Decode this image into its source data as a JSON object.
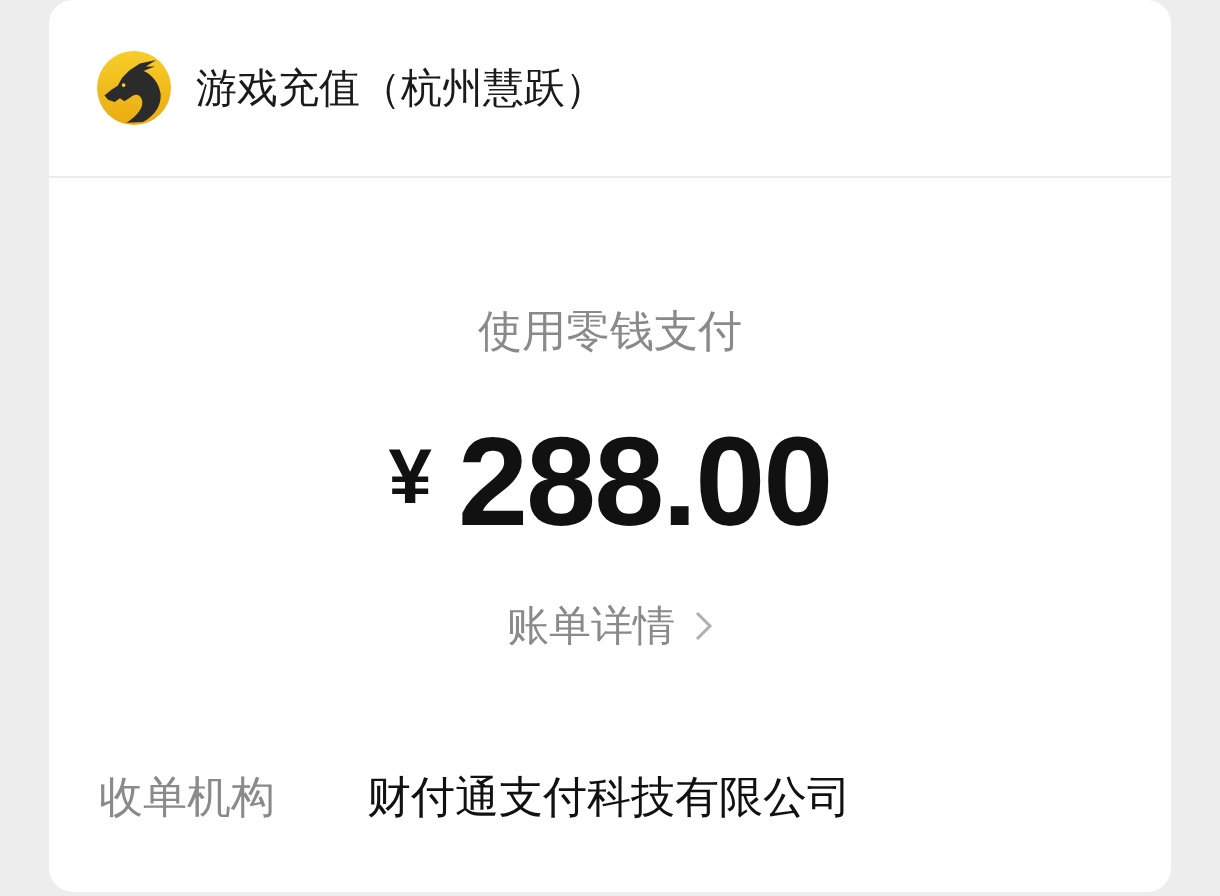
{
  "header": {
    "title": "游戏充值（杭州慧跃）"
  },
  "payment_method": "使用零钱支付",
  "amount": {
    "currency": "¥",
    "value": "288.00"
  },
  "bill_details_link": {
    "label": "账单详情"
  },
  "details": [
    {
      "label": "收单机构",
      "value": "财付通支付科技有限公司"
    }
  ]
}
